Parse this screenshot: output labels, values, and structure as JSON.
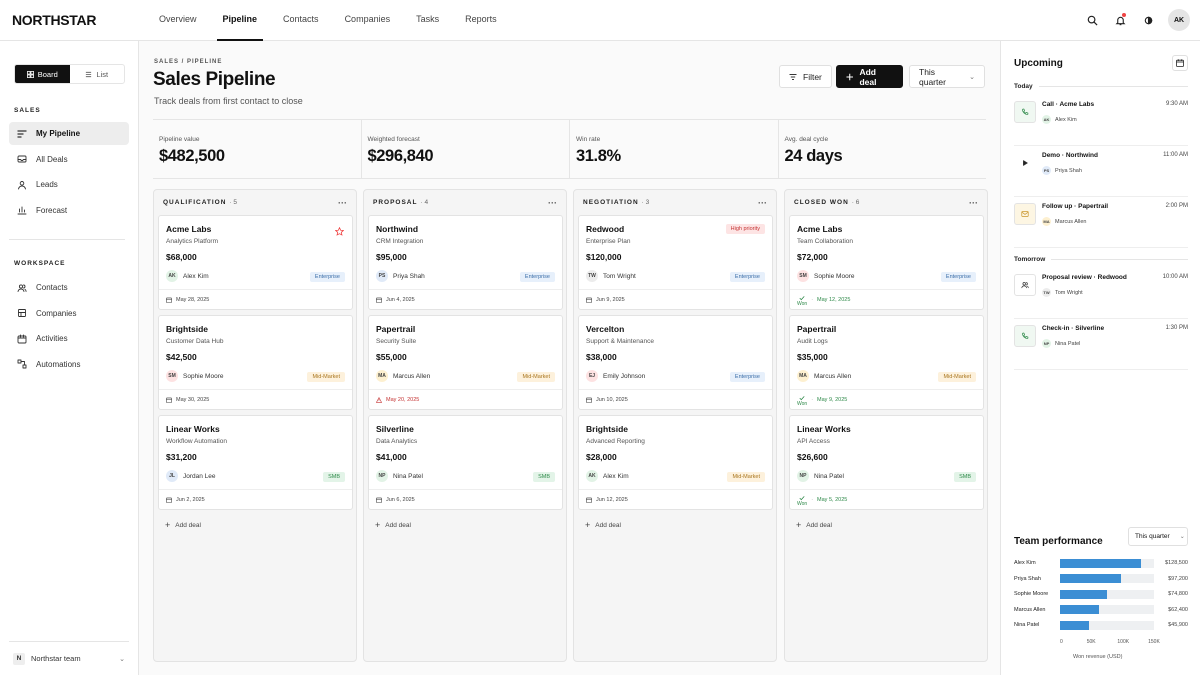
{
  "app": {
    "logo": "NORTHSTAR",
    "nav": [
      "Overview",
      "Pipeline",
      "Contacts",
      "Companies",
      "Tasks",
      "Reports"
    ],
    "active_nav": "Pipeline",
    "user_initials": "AK"
  },
  "sidebar": {
    "view_toggle": {
      "board": "Board",
      "list": "List"
    },
    "sales_label": "SALES",
    "sales_items": [
      {
        "label": "My Pipeline",
        "icon": "pipeline-icon"
      },
      {
        "label": "All Deals",
        "icon": "inbox-icon"
      },
      {
        "label": "Leads",
        "icon": "user-icon"
      },
      {
        "label": "Forecast",
        "icon": "bar-chart-icon"
      }
    ],
    "workspace_label": "WORKSPACE",
    "workspace_items": [
      {
        "label": "Contacts",
        "icon": "users-icon"
      },
      {
        "label": "Companies",
        "icon": "building-icon"
      },
      {
        "label": "Activities",
        "icon": "calendar-icon"
      },
      {
        "label": "Automations",
        "icon": "automation-icon"
      }
    ],
    "team": {
      "initial": "N",
      "name": "Northstar team"
    }
  },
  "header": {
    "breadcrumb": "SALES / PIPELINE",
    "title": "Sales Pipeline",
    "subtitle": "Track deals from first contact to close",
    "filter": "Filter",
    "add_deal": "Add deal",
    "period": "This quarter"
  },
  "stats": [
    {
      "label": "Pipeline value",
      "value": "$482,500"
    },
    {
      "label": "Weighted forecast",
      "value": "$296,840"
    },
    {
      "label": "Win rate",
      "value": "31.8%"
    },
    {
      "label": "Avg. deal cycle",
      "value": "24 days"
    }
  ],
  "columns": [
    {
      "title": "QUALIFICATION",
      "count": "· 5",
      "add": "Add deal",
      "cards": [
        {
          "name": "Acme Labs",
          "sub": "Analytics Platform",
          "amount": "$68,000",
          "initials": "AK",
          "owner": "Alex Kim",
          "tag": "Enterprise",
          "date": "May 28, 2025",
          "starred": true
        },
        {
          "name": "Brightside",
          "sub": "Customer Data Hub",
          "amount": "$42,500",
          "initials": "SM",
          "owner": "Sophie Moore",
          "tag": "Mid-Market",
          "date": "May 30, 2025"
        },
        {
          "name": "Linear Works",
          "sub": "Workflow Automation",
          "amount": "$31,200",
          "initials": "JL",
          "owner": "Jordan Lee",
          "tag": "SMB",
          "date": "Jun 2, 2025"
        }
      ]
    },
    {
      "title": "PROPOSAL",
      "count": "· 4",
      "add": "Add deal",
      "cards": [
        {
          "name": "Northwind",
          "sub": "CRM Integration",
          "amount": "$95,000",
          "initials": "PS",
          "owner": "Priya Shah",
          "tag": "Enterprise",
          "date": "Jun 4, 2025"
        },
        {
          "name": "Papertrail",
          "sub": "Security Suite",
          "amount": "$55,000",
          "initials": "MA",
          "owner": "Marcus Allen",
          "tag": "Mid-Market",
          "date": "May 20, 2025",
          "overdue": true
        },
        {
          "name": "Silverline",
          "sub": "Data Analytics",
          "amount": "$41,000",
          "initials": "NP",
          "owner": "Nina Patel",
          "tag": "SMB",
          "date": "Jun 6, 2025"
        }
      ]
    },
    {
      "title": "NEGOTIATION",
      "count": "· 3",
      "add": "Add deal",
      "cards": [
        {
          "name": "Redwood",
          "sub": "Enterprise Plan",
          "amount": "$120,000",
          "initials": "TW",
          "owner": "Tom Wright",
          "tag": "Enterprise",
          "date": "Jun 9, 2025",
          "priority": "High priority"
        },
        {
          "name": "Vercelton",
          "sub": "Support & Maintenance",
          "amount": "$38,000",
          "initials": "EJ",
          "owner": "Emily Johnson",
          "tag": "Enterprise",
          "date": "Jun 10, 2025"
        },
        {
          "name": "Brightside",
          "sub": "Advanced Reporting",
          "amount": "$28,000",
          "initials": "AK",
          "owner": "Alex Kim",
          "tag": "Mid-Market",
          "date": "Jun 12, 2025"
        }
      ]
    },
    {
      "title": "CLOSED WON",
      "count": "· 6",
      "add": "Add deal",
      "cards": [
        {
          "name": "Acme Labs",
          "sub": "Team Collaboration",
          "amount": "$72,000",
          "initials": "SM",
          "owner": "Sophie Moore",
          "tag": "Enterprise",
          "date": "May 12, 2025",
          "won": "Won"
        },
        {
          "name": "Papertrail",
          "sub": "Audit Logs",
          "amount": "$35,000",
          "initials": "MA",
          "owner": "Marcus Allen",
          "tag": "Mid-Market",
          "date": "May 9, 2025",
          "won": "Won"
        },
        {
          "name": "Linear Works",
          "sub": "API Access",
          "amount": "$26,600",
          "initials": "NP",
          "owner": "Nina Patel",
          "tag": "SMB",
          "date": "May 5, 2025",
          "won": "Won"
        }
      ]
    }
  ],
  "upcoming": {
    "title": "Upcoming",
    "today_label": "Today",
    "tomorrow_label": "Tomorrow",
    "today": [
      {
        "title": "Call · Acme Labs",
        "time": "9:30 AM",
        "initials": "AK",
        "person": "Alex Kim",
        "icon": "phone-icon"
      },
      {
        "title": "Demo · Northwind",
        "time": "11:00 AM",
        "initials": "PS",
        "person": "Priya Shah",
        "icon": "play-icon"
      },
      {
        "title": "Follow up · Papertrail",
        "time": "2:00 PM",
        "initials": "MA",
        "person": "Marcus Allen",
        "icon": "mail-icon"
      }
    ],
    "tomorrow": [
      {
        "title": "Proposal review · Redwood",
        "time": "10:00 AM",
        "initials": "TW",
        "person": "Tom Wright",
        "icon": "users-icon"
      },
      {
        "title": "Check-in · Silverline",
        "time": "1:30 PM",
        "initials": "NP",
        "person": "Nina Patel",
        "icon": "phone-icon"
      }
    ]
  },
  "team_performance": {
    "title": "Team performance",
    "period": "This quarter"
  },
  "chart_data": {
    "type": "bar",
    "orientation": "horizontal",
    "categories": [
      "Alex Kim",
      "Priya Shah",
      "Sophie Moore",
      "Marcus Allen",
      "Nina Patel"
    ],
    "values": [
      128500,
      97200,
      74800,
      62400,
      45900
    ],
    "value_labels": [
      "$128,500",
      "$97,200",
      "$74,800",
      "$62,400",
      "$45,900"
    ],
    "xlabel": "Won revenue (USD)",
    "xticks": [
      "0",
      "50K",
      "100K",
      "150K"
    ],
    "xlim": [
      0,
      150000
    ],
    "color": "#3b8ed4"
  }
}
